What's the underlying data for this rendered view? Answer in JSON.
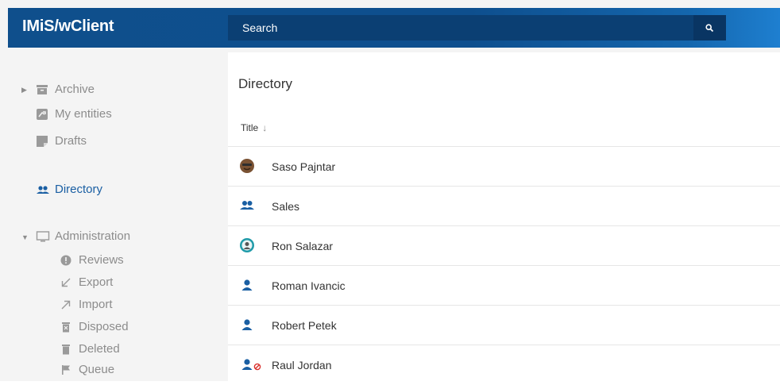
{
  "header": {
    "app_title": "IMiS/wClient",
    "search_placeholder": "Search"
  },
  "sidebar": {
    "archive": "Archive",
    "my_entities": "My entities",
    "drafts": "Drafts",
    "directory": "Directory",
    "administration": "Administration",
    "admin_items": [
      "Reviews",
      "Export",
      "Import",
      "Disposed",
      "Deleted",
      "Queue"
    ]
  },
  "main": {
    "title": "Directory",
    "column_title": "Title",
    "rows": [
      {
        "label": "Saso Pajntar",
        "icon": "avatar-photo"
      },
      {
        "label": "Sales",
        "icon": "group-icon"
      },
      {
        "label": "Ron Salazar",
        "icon": "avatar-photo"
      },
      {
        "label": "Roman Ivancic",
        "icon": "user-icon"
      },
      {
        "label": "Robert Petek",
        "icon": "user-icon"
      },
      {
        "label": "Raul Jordan",
        "icon": "user-blocked-icon"
      }
    ]
  },
  "colors": {
    "brand_blue": "#0f4f8c",
    "active_blue": "#1a5fa3",
    "sidebar_bg": "#f4f4f4",
    "blocked_red": "#d9302c"
  }
}
